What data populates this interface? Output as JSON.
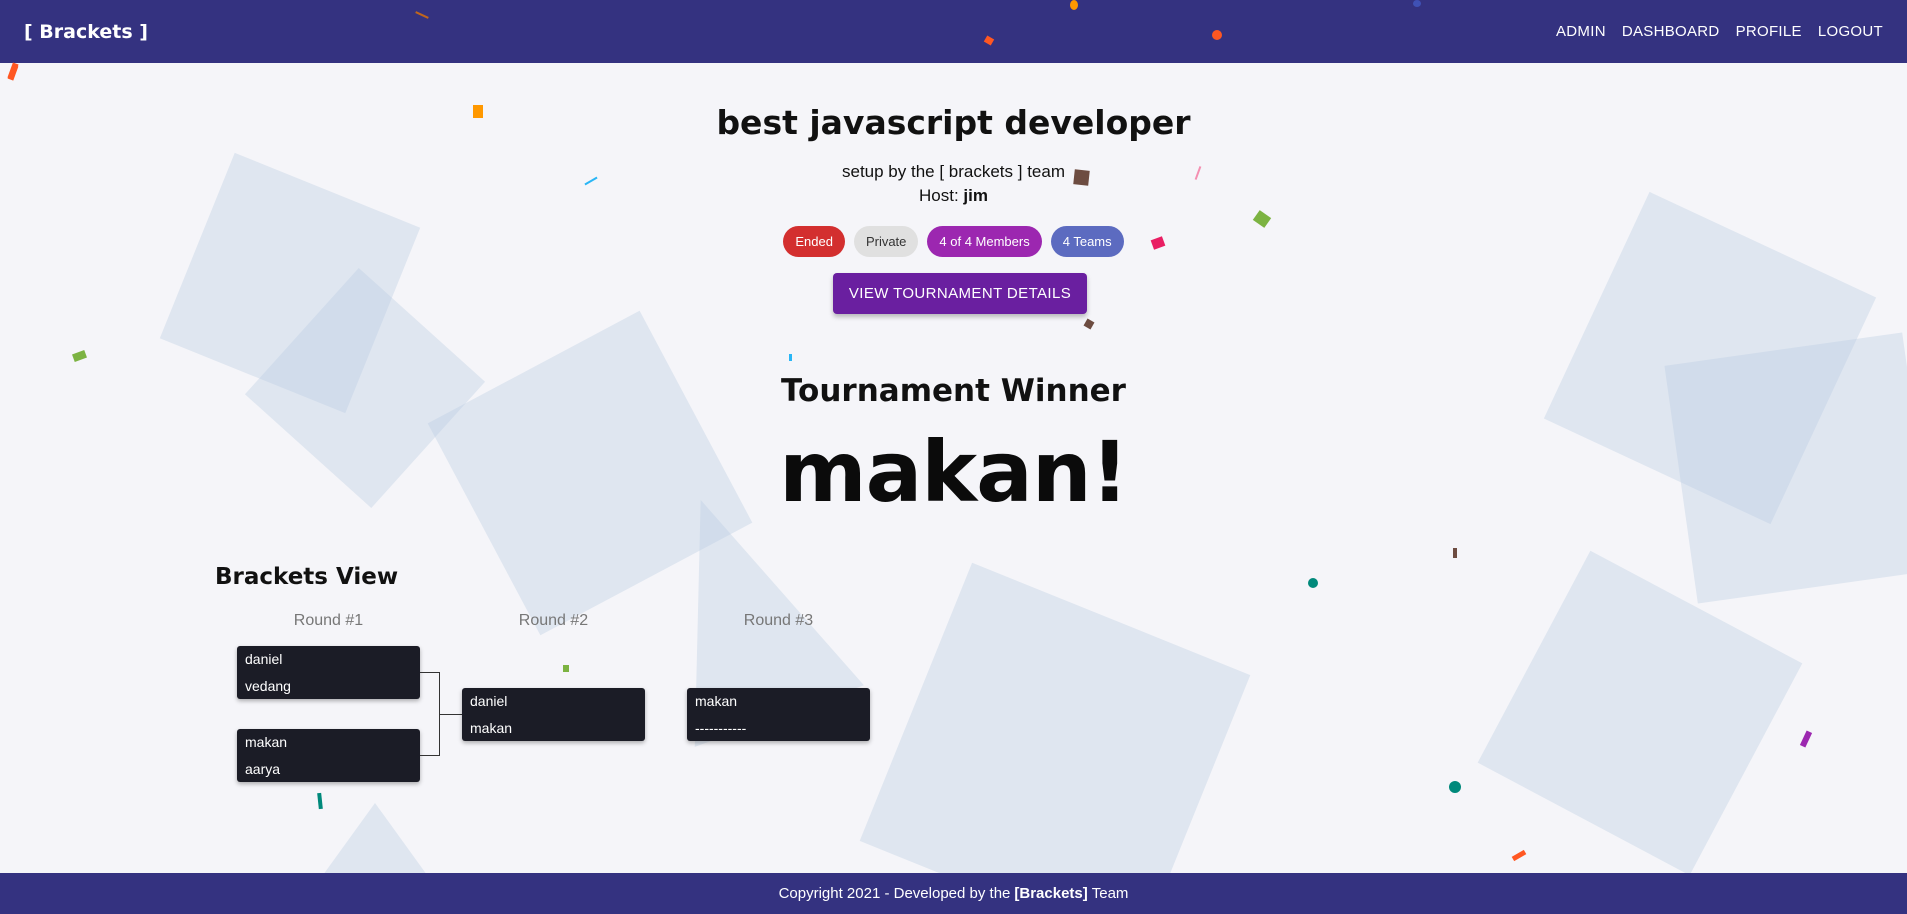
{
  "navbar": {
    "brand": "[ Brackets ]",
    "links": [
      "ADMIN",
      "DASHBOARD",
      "PROFILE",
      "LOGOUT"
    ]
  },
  "tournament": {
    "title": "best javascript developer",
    "subtitle": "setup by the [ brackets ] team",
    "host_label": "Host:",
    "host_name": "jim",
    "chips": {
      "status": "Ended",
      "visibility": "Private",
      "members": "4 of 4 Members",
      "teams": "4 Teams"
    },
    "details_button": "VIEW TOURNAMENT DETAILS"
  },
  "winner": {
    "label": "Tournament Winner",
    "name": "makan!"
  },
  "brackets": {
    "title": "Brackets View",
    "rounds": [
      {
        "label": "Round #1",
        "matches": [
          {
            "team1": "daniel",
            "team2": "vedang"
          },
          {
            "team1": "makan",
            "team2": "aarya"
          }
        ]
      },
      {
        "label": "Round #2",
        "matches": [
          {
            "team1": "daniel",
            "team2": "makan"
          }
        ]
      },
      {
        "label": "Round #3",
        "matches": [
          {
            "team1": "makan",
            "team2": "-----------"
          }
        ]
      }
    ]
  },
  "footer": {
    "prefix": "Copyright 2021 - Developed by the",
    "brand": "[Brackets]",
    "suffix": "Team"
  },
  "colors": {
    "navbar": "#343280",
    "ended": "#d32f2f",
    "private": "#e0e0e0",
    "members": "#9c27b0",
    "teams": "#5c6bc0",
    "button": "#6a1fa0",
    "match_box": "#1b1c26"
  }
}
